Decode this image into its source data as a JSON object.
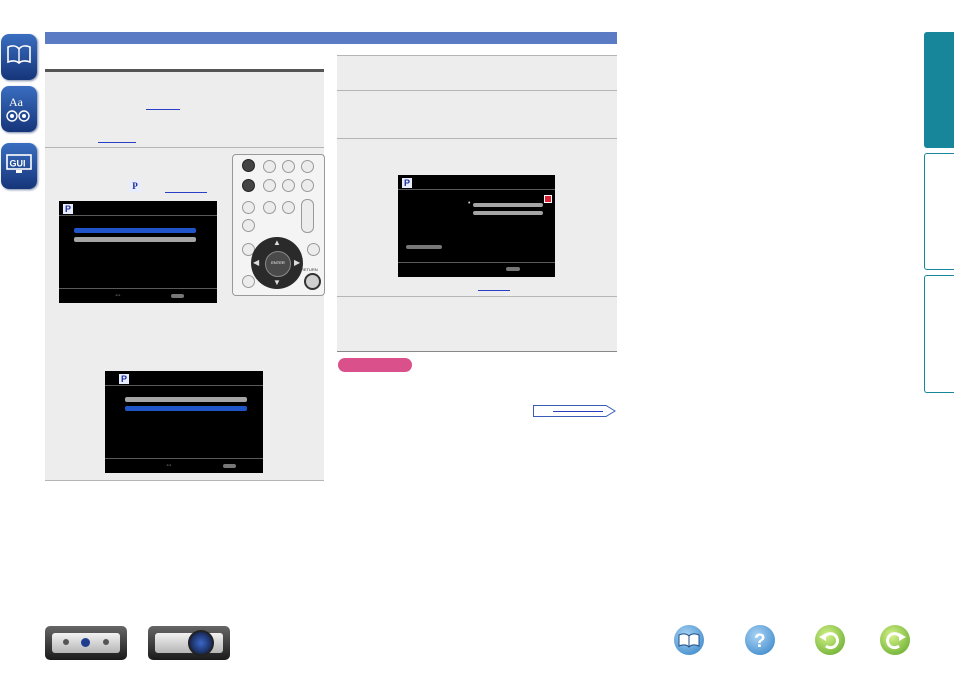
{
  "page": {
    "left_tabs": [
      "contents-book-icon",
      "index-aa-icon",
      "gui-icon"
    ],
    "right_tabs_color": "#17859a",
    "header_bar_color": "#5b7cc4",
    "screen1": {
      "icon_letter": "P",
      "footer_symbol": "⇔"
    },
    "screen2": {
      "icon_letter": "P",
      "footer_symbol": "⇔"
    },
    "screen3": {
      "icon_letter": "P",
      "bullet": "•"
    },
    "text_icon_letter": "P",
    "remote": {
      "center_label": "ENTER",
      "return_label": "RETURN"
    },
    "caution_color": "#d9508a",
    "bottom_nav_icons": [
      "contents-book-icon",
      "help-question-icon",
      "back-arrow-icon",
      "forward-arrow-icon"
    ],
    "devices": [
      "amplifier-device-icon",
      "projector-device-icon"
    ]
  }
}
